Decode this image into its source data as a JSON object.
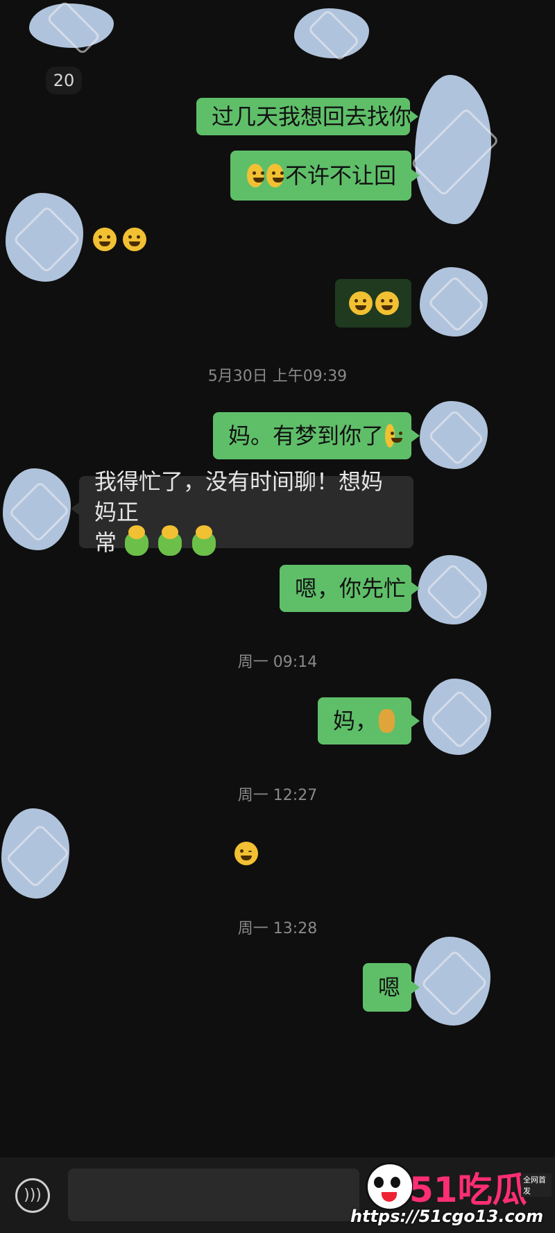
{
  "unread_badge": "20",
  "messages": [
    {
      "side": "me",
      "text": "过几天我想回去找你"
    },
    {
      "side": "me",
      "text": "不许不让回"
    },
    {
      "side": "other_emoji"
    },
    {
      "side": "me_emoji"
    },
    {
      "side": "time",
      "text": "5月30日 上午09:39"
    },
    {
      "side": "me",
      "text": "妈。有梦到你了"
    },
    {
      "side": "other",
      "line1": "我得忙了，没有时间聊！想妈妈正",
      "line2": "常"
    },
    {
      "side": "me",
      "text": "嗯，你先忙"
    },
    {
      "side": "time",
      "text": "周一 09:14"
    },
    {
      "side": "me",
      "text": "妈，"
    },
    {
      "side": "time",
      "text": "周一 12:27"
    },
    {
      "side": "other_emoji"
    },
    {
      "side": "time",
      "text": "周一 13:28"
    },
    {
      "side": "me",
      "text": "嗯"
    }
  ],
  "watermark": {
    "logo": "51吃瓜",
    "tag": "全网首发",
    "url": "https://51cgo13.com"
  },
  "icons": {
    "voice": "voice-icon"
  }
}
